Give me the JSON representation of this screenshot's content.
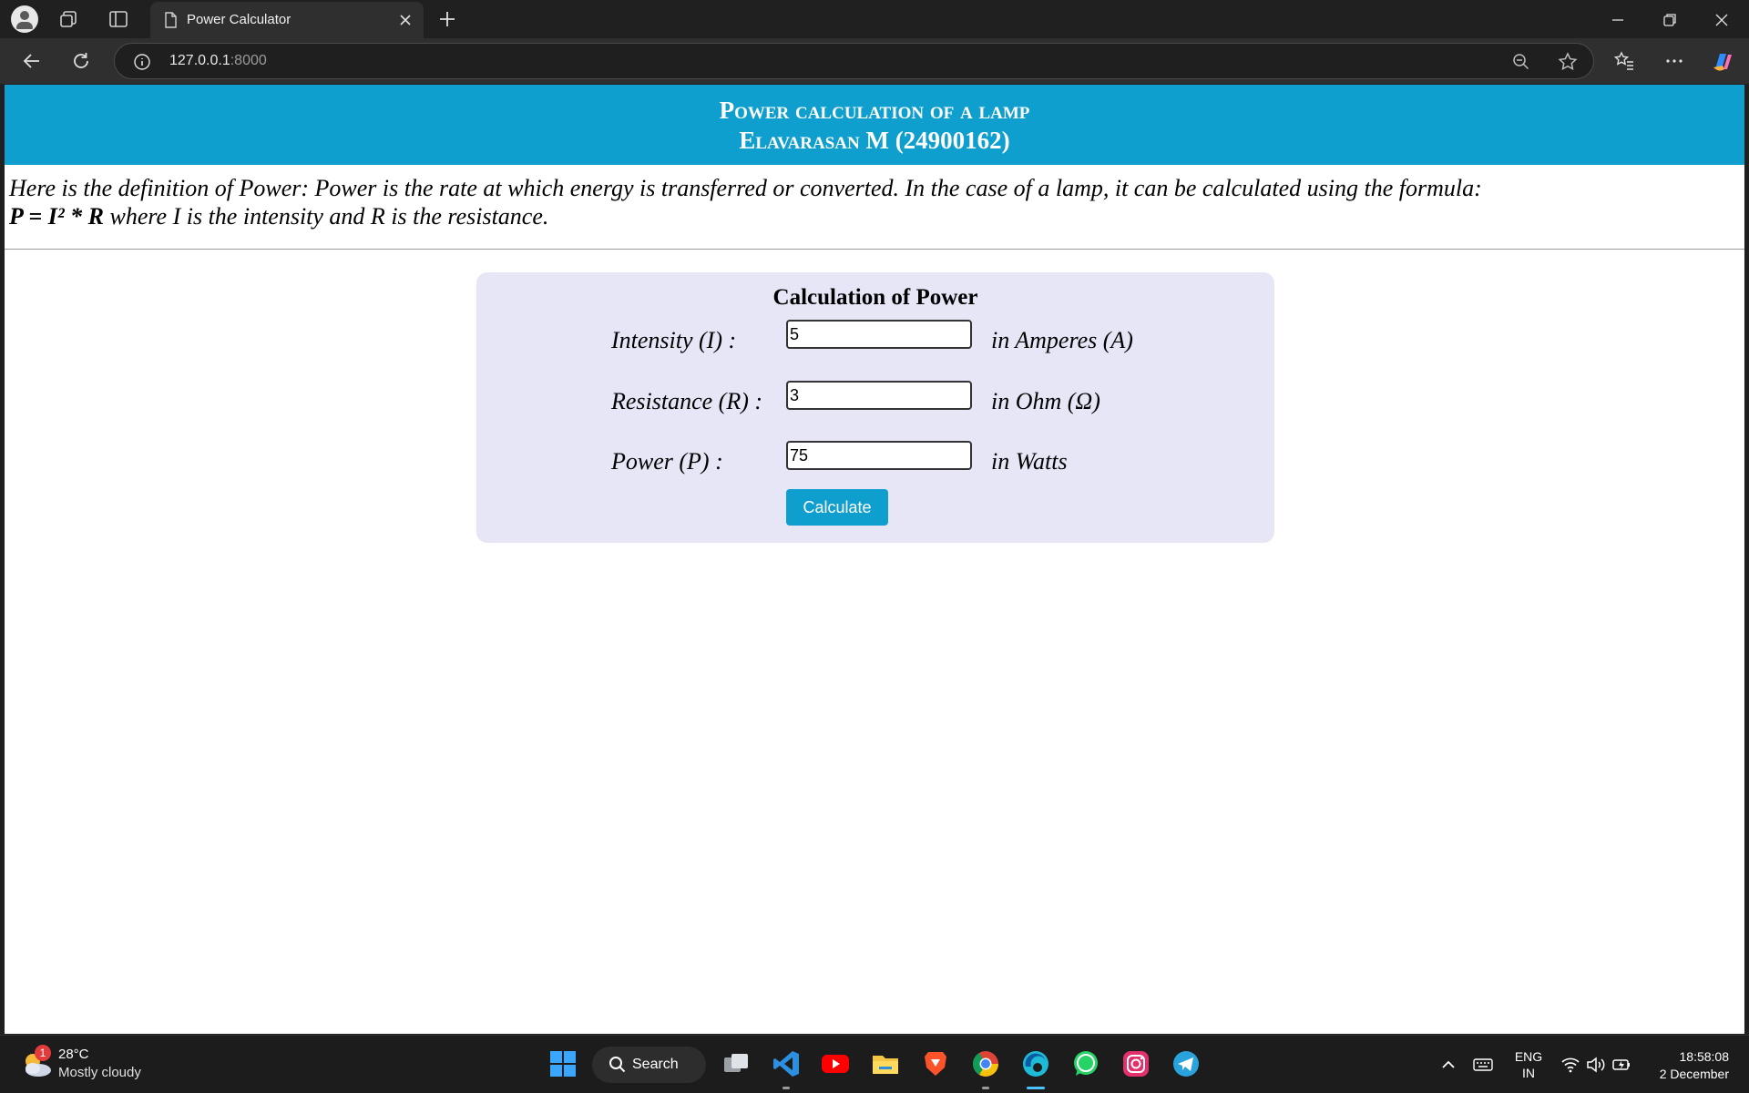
{
  "browser": {
    "tab_title": "Power Calculator",
    "url_host": "127.0.0.1",
    "url_port": ":8000"
  },
  "page": {
    "header_line1": "Power calculation of a lamp",
    "header_line2": "Elavarasan M (24900162)",
    "definition_text": "Here is the definition of Power: Power is the rate at which energy is transferred or converted. In the case of a lamp, it can be calculated using the formula:",
    "formula": "P = I² * R",
    "formula_explanation": " where I is the intensity and R is the resistance."
  },
  "calculator": {
    "title": "Calculation of Power",
    "intensity": {
      "label": "Intensity (I) :",
      "value": "5",
      "unit": "in Amperes (A)"
    },
    "resistance": {
      "label": "Resistance (R) :",
      "value": "3",
      "unit": "in Ohm (Ω)"
    },
    "power": {
      "label": "Power (P) :",
      "value": "75",
      "unit": "in Watts"
    },
    "button_label": "Calculate"
  },
  "taskbar": {
    "weather_temp": "28°C",
    "weather_desc": "Mostly cloudy",
    "weather_badge": "1",
    "search_label": "Search",
    "lang_line1": "ENG",
    "lang_line2": "IN",
    "time": "18:58:08",
    "date": "2 December",
    "apps": [
      "task-view",
      "vscode",
      "youtube",
      "file-explorer",
      "brave",
      "chrome",
      "edge",
      "whatsapp",
      "instagram",
      "telegram"
    ]
  },
  "colors": {
    "header_bg": "#0f9fcf",
    "card_bg": "#e6e6f7",
    "button_bg": "#0f9fcf"
  }
}
